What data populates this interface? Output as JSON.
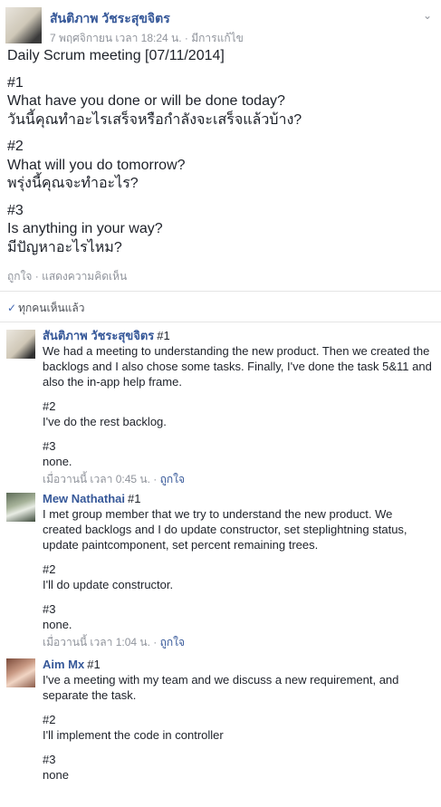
{
  "post": {
    "author": "สันติภาพ วัชระสุขจิตร",
    "date": "7 พฤศจิกายน เวลา 18:24 น.",
    "edited": "มีการแก้ไข",
    "meta_sep": " · ",
    "lines": [
      "Daily Scrum meeting [07/11/2014]",
      "",
      "#1",
      "What have you done or will be done today?",
      "วันนี้คุณทำอะไรเสร็จหรือกำลังจะเสร็จแล้วบ้าง?",
      "",
      "#2",
      "What will you do tomorrow?",
      "พรุ่งนี้คุณจะทำอะไร?",
      "",
      "#3",
      "Is anything in your way?",
      "มีปัญหาอะไรไหม?"
    ],
    "like_label": "ถูกใจ",
    "comment_label": "แสดงความคิดเห็น",
    "action_sep": " · "
  },
  "seen": {
    "check_icon": "✓",
    "label": "ทุกคนเห็นแล้ว"
  },
  "comments": [
    {
      "name": "สันติภาพ วัชระสุขจิตร",
      "first_line": "#1",
      "body1": "We had a meeting to understanding the new product. Then we created the backlogs and I also chose some tasks. Finally, I've done the task 5&11 and also the in-app help frame.",
      "h2": "#2",
      "body2": "I've do the rest backlog.",
      "h3": "#3",
      "body3": "none.",
      "time": "เมื่อวานนี้ เวลา 0:45 น.",
      "like": "ถูกใจ"
    },
    {
      "name": "Mew Nathathai",
      "first_line": "#1",
      "body1": "I met group member that we try to understand the new product. We created backlogs and I do update constructor, set steplightning status, update paintcomponent, set percent remaining trees.",
      "h2": "#2",
      "body2": "I'll do update constructor.",
      "h3": "#3",
      "body3": "none.",
      "time": "เมื่อวานนี้ เวลา 1:04 น.",
      "like": "ถูกใจ"
    },
    {
      "name": "Aim Mx",
      "first_line": "#1",
      "body1": "I've a meeting with my team and we discuss a new requirement, and separate the task.",
      "h2": "#2",
      "body2": "I'll implement the code in controller",
      "h3": "#3",
      "body3": "none"
    }
  ],
  "meta_sep": " · ",
  "chevron_icon": "⌄"
}
